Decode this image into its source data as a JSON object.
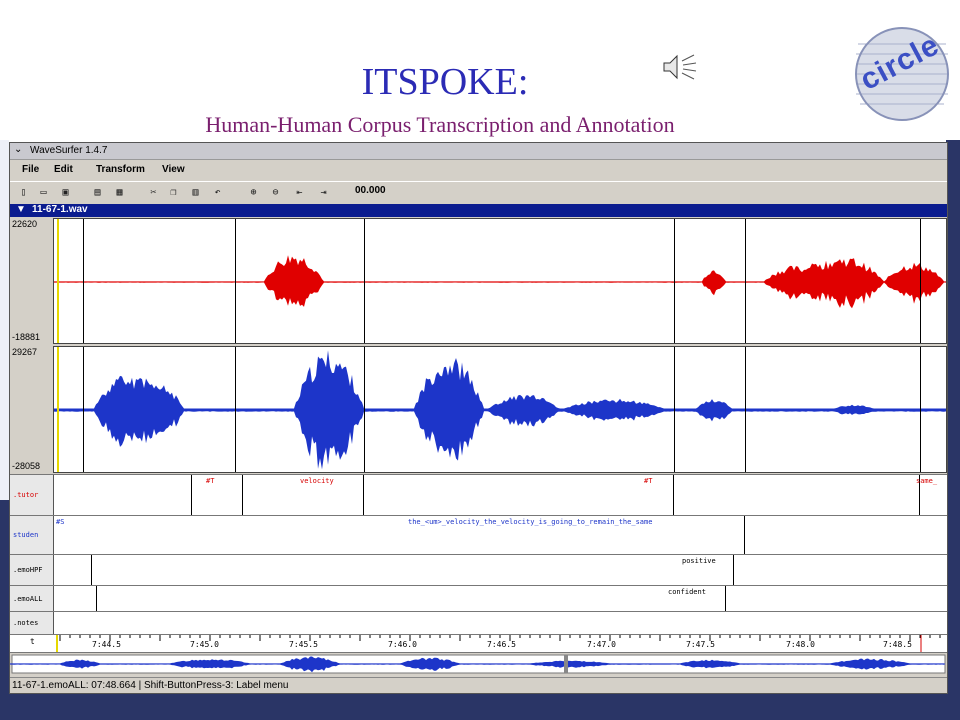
{
  "slide": {
    "title": "ITSPOKE:",
    "subtitle": "Human-Human Corpus Transcription and Annotation",
    "logo_text": "circle",
    "speaker_icon": "speaker-icon",
    "colors": {
      "title": "#2b2bb5",
      "subtitle": "#7a1f6e",
      "background_right": "#2a3566"
    }
  },
  "window": {
    "title": "WaveSurfer 1.4.7",
    "menu": [
      "File",
      "Edit",
      "Transform",
      "View"
    ],
    "toolbar_icons": [
      "new-icon",
      "open-icon",
      "save-icon",
      "print-icon",
      "properties-icon",
      "cut-icon",
      "copy-icon",
      "paste-icon",
      "undo-icon",
      "zoom-in-icon",
      "zoom-out-icon",
      "zoom-fit-icon",
      "zoom-select-icon"
    ],
    "time_display": "00.000",
    "file_name": "11-67-1.wav"
  },
  "waveforms": [
    {
      "max_label": "22620",
      "min_label": "-18881",
      "color": "#e00000"
    },
    {
      "max_label": "29267",
      "min_label": "-28058",
      "color": "#1d35c9"
    }
  ],
  "tiers": [
    {
      "name": ".tutor",
      "labels": [
        "#T",
        "velocity",
        "#T",
        "same_"
      ]
    },
    {
      "name": "studen",
      "labels": [
        "#S",
        "the_<um>_velocity_the_velocity_is_going_to_remain_the_same"
      ]
    },
    {
      "name": ".emoHPF",
      "labels": [
        "positive"
      ]
    },
    {
      "name": ".emoALL",
      "labels": [
        "confident"
      ]
    },
    {
      "name": ".notes",
      "labels": []
    }
  ],
  "ruler": {
    "label": "t",
    "ticks": [
      "7:44.5",
      "7:45.0",
      "7:45.5",
      "7:46.0",
      "7:46.5",
      "7:47.0",
      "7:47.5",
      "7:48.0",
      "7:48.5"
    ]
  },
  "status": "11-67-1.emoALL: 07:48.664 | Shift-ButtonPress-3: Label menu"
}
